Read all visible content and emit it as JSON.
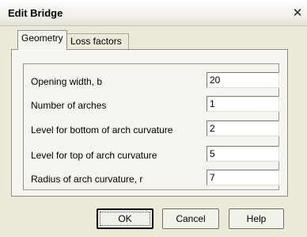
{
  "window": {
    "title": "Edit Bridge",
    "close_label": "✕"
  },
  "tabs": [
    {
      "label": "Geometry",
      "active": true
    },
    {
      "label": "Loss factors",
      "active": false
    }
  ],
  "fields": [
    {
      "label": "Opening width, b",
      "value": "20"
    },
    {
      "label": "Number of  arches",
      "value": "1"
    },
    {
      "label": "Level for bottom of arch curvature",
      "value": "2"
    },
    {
      "label": "Level for top of arch curvature",
      "value": "5"
    },
    {
      "label": "Radius of arch curvature, r",
      "value": "7"
    }
  ],
  "buttons": {
    "ok": "OK",
    "cancel": "Cancel",
    "help": "Help"
  }
}
